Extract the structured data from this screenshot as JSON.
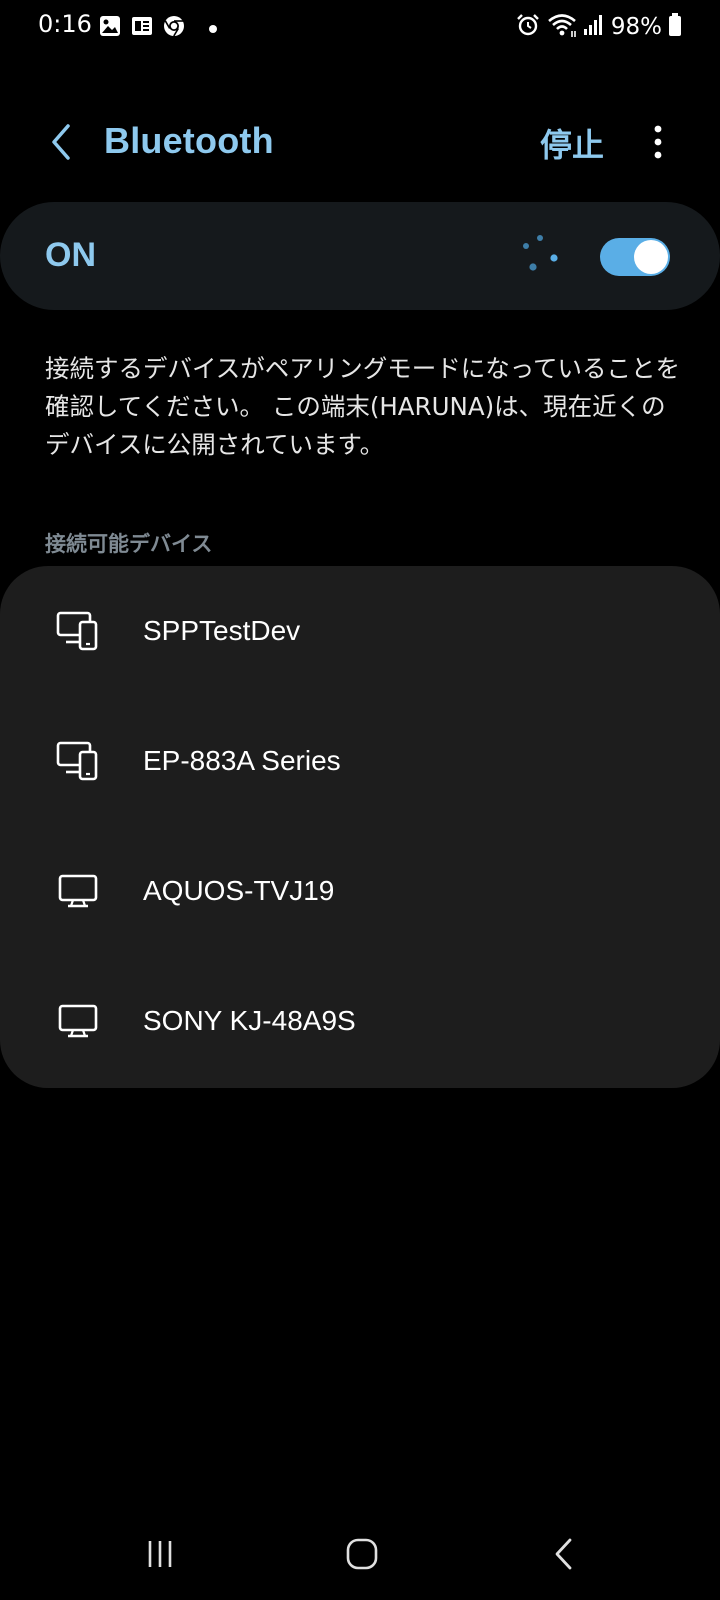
{
  "status_bar": {
    "time": "0:16",
    "battery_percent": "98%",
    "left_icons": [
      "gallery-icon",
      "news-icon",
      "chrome-icon",
      "dot-icon"
    ],
    "right_icons": [
      "alarm-icon",
      "wifi-icon",
      "signal-icon",
      "battery-icon"
    ]
  },
  "header": {
    "title": "Bluetooth",
    "stop_label": "停止"
  },
  "toggle": {
    "label": "ON",
    "state": "on"
  },
  "description": "接続するデバイスがペアリングモードになっていることを確認してください。 この端末(HARUNA)は、現在近くのデバイスに公開されています。",
  "available_devices": {
    "header": "接続可能デバイス",
    "items": [
      {
        "name": "SPPTestDev",
        "icon": "phone-computer-icon"
      },
      {
        "name": "EP-883A Series",
        "icon": "phone-computer-icon"
      },
      {
        "name": "AQUOS-TVJ19",
        "icon": "tv-icon"
      },
      {
        "name": "SONY KJ-48A9S",
        "icon": "tv-icon"
      }
    ]
  },
  "nav_bar": {
    "icons": [
      "recents-icon",
      "home-icon",
      "back-icon"
    ]
  },
  "colors": {
    "accent": "#8ec9ee",
    "switch_track": "#5aaee6",
    "toggle_card_bg": "#15191c",
    "list_card_bg": "#1d1d1d",
    "section_header": "#7f8a93"
  }
}
